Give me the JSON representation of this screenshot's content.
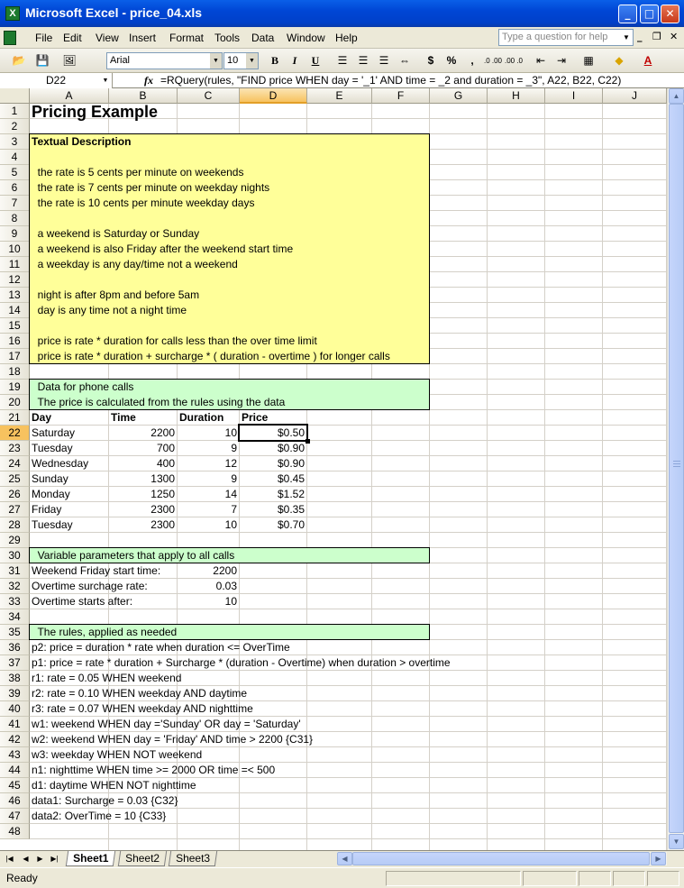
{
  "window": {
    "app_icon": "excel-icon",
    "title": "Microsoft Excel - price_04.xls",
    "controls": {
      "minimize": "minimize-icon",
      "maximize": "maximize-icon",
      "close": "close-icon"
    }
  },
  "menubar": {
    "items": [
      "File",
      "Edit",
      "View",
      "Insert",
      "Format",
      "Tools",
      "Data",
      "Window",
      "Help"
    ],
    "help_placeholder": "Type a question for help"
  },
  "toolbar": {
    "font_name": "Arial",
    "font_size": "10",
    "bold": "B",
    "italic": "I",
    "underline": "U",
    "currency": "$",
    "percent": "%",
    "comma": ",",
    "increase_decimal": ".0→.00",
    "decrease_decimal": ".00→.0"
  },
  "formula_bar": {
    "name_box": "D22",
    "fx": "fx",
    "formula": "=RQuery(rules, \"FIND price WHEN day = '_1' AND time = _2 and duration = _3\", A22, B22, C22)"
  },
  "columns": [
    "A",
    "B",
    "C",
    "D",
    "E",
    "F",
    "G",
    "H",
    "I",
    "J"
  ],
  "rows": [
    "1",
    "2",
    "3",
    "4",
    "5",
    "6",
    "7",
    "8",
    "9",
    "10",
    "11",
    "12",
    "13",
    "14",
    "15",
    "16",
    "17",
    "18",
    "19",
    "20",
    "21",
    "22",
    "23",
    "24",
    "25",
    "26",
    "27",
    "28",
    "29",
    "30",
    "31",
    "32",
    "33",
    "34",
    "35",
    "36",
    "37",
    "38",
    "39",
    "40",
    "41",
    "42",
    "43",
    "44",
    "45",
    "46",
    "47",
    "48"
  ],
  "selected_cell": {
    "column": "D",
    "row": "22"
  },
  "colors": {
    "yellow_box": "#ffff99",
    "green_box": "#ccffcc",
    "selection_header": "#f7c25f"
  },
  "sheet": {
    "title": "Pricing Example",
    "textual_heading": "Textual Description",
    "textual_lines": [
      "  the rate is 5 cents per minute on weekends",
      "  the rate is 7 cents per minute on weekday nights",
      "  the rate is 10 cents per minute weekday days",
      "",
      "  a weekend is Saturday or Sunday",
      "  a weekend is also Friday after the weekend start time",
      "  a weekday is any day/time not a weekend",
      "",
      "  night is after 8pm and before 5am",
      "  day is any time not a night time",
      "",
      "  price is rate * duration for calls less than the over time limit",
      "  price is rate * duration + surcharge * ( duration - overtime ) for longer calls"
    ],
    "data_header_lines": [
      "  Data for phone calls",
      "  The price is calculated from the rules using the data"
    ],
    "table_headers": [
      "Day",
      "Time",
      "Duration",
      "Price"
    ],
    "calls": [
      {
        "day": "Saturday",
        "time": "2200",
        "duration": "10",
        "price": "$0.50"
      },
      {
        "day": "Tuesday",
        "time": "700",
        "duration": "9",
        "price": "$0.90"
      },
      {
        "day": "Wednesday",
        "time": "400",
        "duration": "12",
        "price": "$0.90"
      },
      {
        "day": "Sunday",
        "time": "1300",
        "duration": "9",
        "price": "$0.45"
      },
      {
        "day": "Monday",
        "time": "1250",
        "duration": "14",
        "price": "$1.52"
      },
      {
        "day": "Friday",
        "time": "2300",
        "duration": "7",
        "price": "$0.35"
      },
      {
        "day": "Tuesday",
        "time": "2300",
        "duration": "10",
        "price": "$0.70"
      }
    ],
    "params_header": "  Variable parameters that apply to all calls",
    "params": [
      {
        "label": "Weekend Friday start time:",
        "value": "2200"
      },
      {
        "label": "Overtime surchage rate:",
        "value": "0.03"
      },
      {
        "label": "Overtime starts after:",
        "value": "10"
      }
    ],
    "rules_header": "  The rules, applied as needed",
    "rules": [
      "p2: price = duration * rate when duration <= OverTime",
      "p1: price = rate * duration + Surcharge * (duration - Overtime) when duration > overtime",
      "r1: rate = 0.05 WHEN weekend",
      "r2: rate = 0.10 WHEN weekday AND daytime",
      "r3: rate = 0.07 WHEN weekday AND nighttime",
      "w1: weekend WHEN day ='Sunday' OR day = 'Saturday'",
      "w2: weekend WHEN day = 'Friday' AND time > 2200 {C31}",
      "w3: weekday WHEN NOT weekend",
      "n1: nighttime WHEN time >= 2000 OR time =< 500",
      "d1: daytime WHEN NOT nighttime",
      "data1: Surcharge = 0.03 {C32}",
      "data2: OverTime = 10 {C33}"
    ]
  },
  "sheet_tabs": [
    "Sheet1",
    "Sheet2",
    "Sheet3"
  ],
  "active_tab": "Sheet1",
  "status": "Ready"
}
